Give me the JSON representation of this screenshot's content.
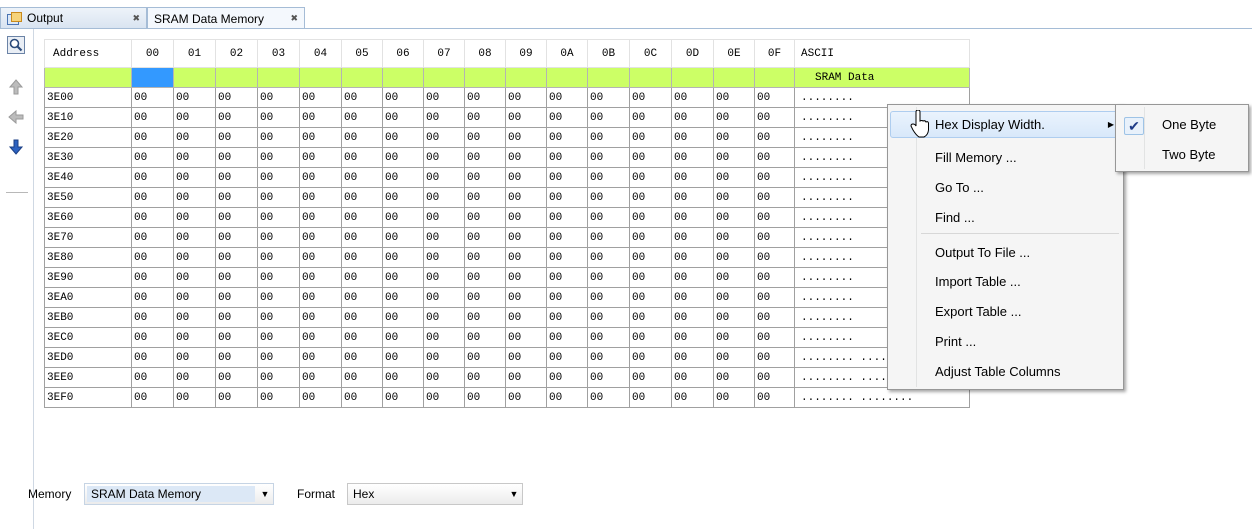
{
  "tabs": [
    {
      "label": "Output",
      "close": "✖"
    },
    {
      "label": "SRAM Data Memory",
      "close": "✖"
    }
  ],
  "table": {
    "columns": [
      "Address",
      "00",
      "01",
      "02",
      "03",
      "04",
      "05",
      "06",
      "07",
      "08",
      "09",
      "0A",
      "0B",
      "0C",
      "0D",
      "0E",
      "0F",
      "ASCII"
    ],
    "section_label": "SRAM Data",
    "rows": [
      {
        "addr": "3E00",
        "ascii": "........"
      },
      {
        "addr": "3E10",
        "ascii": "........"
      },
      {
        "addr": "3E20",
        "ascii": "........"
      },
      {
        "addr": "3E30",
        "ascii": "........"
      },
      {
        "addr": "3E40",
        "ascii": "........"
      },
      {
        "addr": "3E50",
        "ascii": "........"
      },
      {
        "addr": "3E60",
        "ascii": "........"
      },
      {
        "addr": "3E70",
        "ascii": "........"
      },
      {
        "addr": "3E80",
        "ascii": "........"
      },
      {
        "addr": "3E90",
        "ascii": "........"
      },
      {
        "addr": "3EA0",
        "ascii": "........"
      },
      {
        "addr": "3EB0",
        "ascii": "........"
      },
      {
        "addr": "3EC0",
        "ascii": "........"
      },
      {
        "addr": "3ED0",
        "ascii": "........ ........"
      },
      {
        "addr": "3EE0",
        "ascii": "........ ........"
      },
      {
        "addr": "3EF0",
        "ascii": "........ ........"
      }
    ],
    "cell_value": "00"
  },
  "context_menu": {
    "items": [
      {
        "label": "Hex Display Width.",
        "has_submenu": true
      },
      {
        "label": "Fill Memory ..."
      },
      {
        "label": "Go To ..."
      },
      {
        "label": "Find ..."
      },
      {
        "label": "Output To File ..."
      },
      {
        "label": "Import Table ..."
      },
      {
        "label": "Export Table ..."
      },
      {
        "label": "Print ..."
      },
      {
        "label": "Adjust Table Columns"
      }
    ],
    "submenu_arrow": "▶"
  },
  "submenu": {
    "items": [
      {
        "label": "One Byte",
        "checked": true
      },
      {
        "label": "Two Byte",
        "checked": false
      }
    ],
    "check_mark": "✔"
  },
  "bottom": {
    "memory_label": "Memory",
    "memory_value": "SRAM Data Memory",
    "format_label": "Format",
    "format_value": "Hex",
    "dropdown_arrow": "▼"
  },
  "icons": {
    "toolbar": [
      "magnifier-icon",
      "arrow-up-icon",
      "arrow-left-icon",
      "arrow-down-icon"
    ]
  }
}
